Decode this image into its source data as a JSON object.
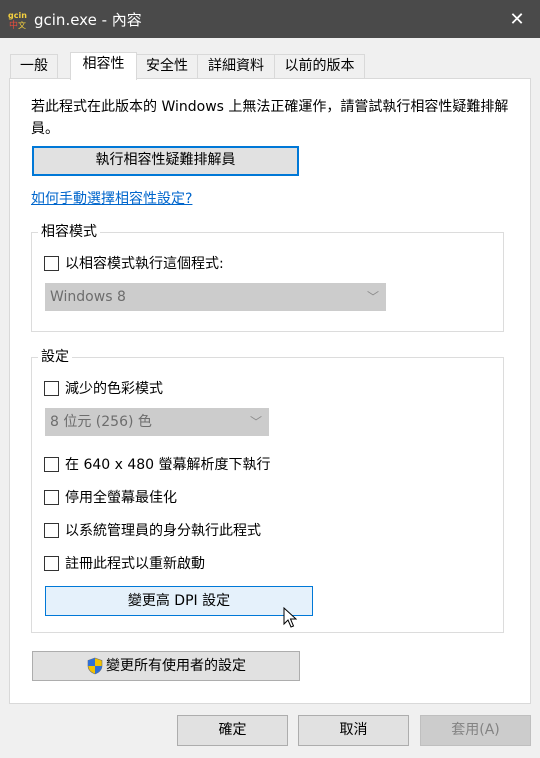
{
  "window": {
    "title": "gcin.exe - 內容",
    "close_glyph": "✕"
  },
  "tabs": [
    {
      "label": "一般"
    },
    {
      "label": "相容性"
    },
    {
      "label": "安全性"
    },
    {
      "label": "詳細資料"
    },
    {
      "label": "以前的版本"
    }
  ],
  "compat": {
    "intro": "若此程式在此版本的 Windows 上無法正確運作，請嘗試執行相容性疑難排解員。",
    "troubleshooter_button": "執行相容性疑難排解員",
    "help_link": "如何手動選擇相容性設定?"
  },
  "mode_group": {
    "title": "相容模式",
    "checkbox_label": "以相容模式執行這個程式:",
    "os_select_value": "Windows 8"
  },
  "settings_group": {
    "title": "設定",
    "reduced_color_label": "減少的色彩模式",
    "color_select_value": "8 位元 (256) 色",
    "res_640_label": "在 640 x 480 螢幕解析度下執行",
    "disable_fullscreen_label": "停用全螢幕最佳化",
    "run_as_admin_label": "以系統管理員的身分執行此程式",
    "register_restart_label": "註冊此程式以重新啟動",
    "dpi_button": "變更高 DPI 設定"
  },
  "all_users_button": "變更所有使用者的設定",
  "footer": {
    "ok": "確定",
    "cancel": "取消",
    "apply": "套用(A)"
  },
  "colors": {
    "titlebar": "#4a4a4a",
    "link": "#0066cc",
    "focus_blue": "#0078d7"
  }
}
